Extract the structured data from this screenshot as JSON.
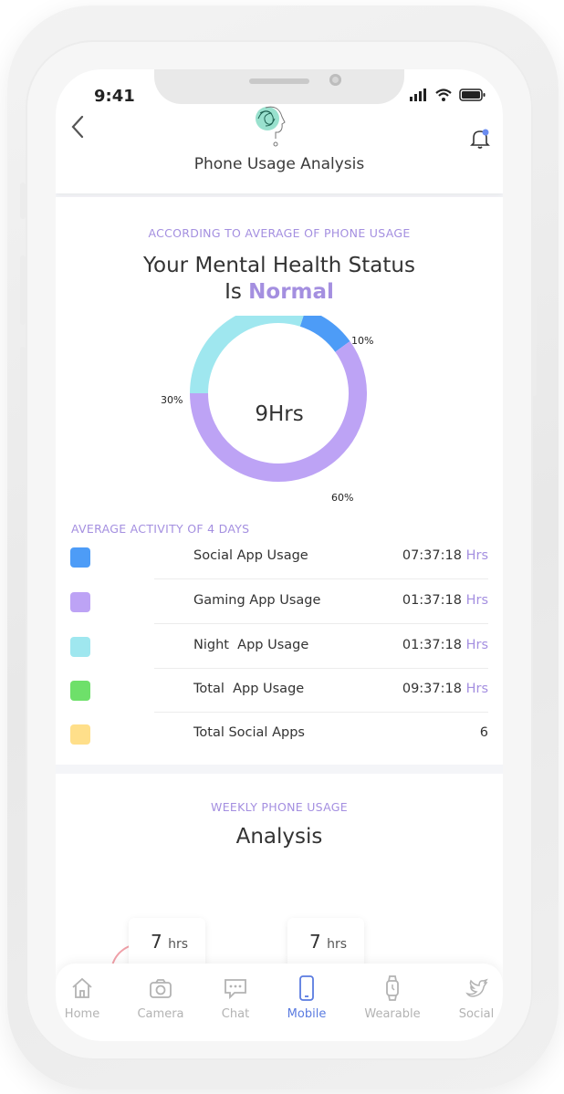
{
  "status_bar": {
    "time": "9:41"
  },
  "header": {
    "title": "Phone Usage Analysis"
  },
  "summary": {
    "caption": "ACCORDING TO AVERAGE OF PHONE USAGE",
    "status_prefix": "Your Mental Health Status",
    "status_is": "Is",
    "status_value": "Normal"
  },
  "chart_data": {
    "type": "pie",
    "center_label": "9Hrs",
    "slices": [
      {
        "label": "10%",
        "value": 10,
        "color": "#4d9cf7"
      },
      {
        "label": "60%",
        "value": 60,
        "color": "#bda3f5"
      },
      {
        "label": "30%",
        "value": 30,
        "color": "#9fe7ef"
      }
    ]
  },
  "activity": {
    "title": "AVERAGE ACTIVITY OF 4 DAYS",
    "rows": [
      {
        "label": "Social App Usage",
        "value": "07:37:18",
        "unit": "Hrs",
        "color": "#4d9cf7"
      },
      {
        "label": "Gaming App Usage",
        "value": "01:37:18",
        "unit": "Hrs",
        "color": "#bda3f5"
      },
      {
        "label": "Night  App Usage",
        "value": "01:37:18",
        "unit": "Hrs",
        "color": "#9fe7ef"
      },
      {
        "label": "Total  App Usage",
        "value": "09:37:18",
        "unit": "Hrs",
        "color": "#6ee06a"
      },
      {
        "label": "Total Social Apps",
        "value": "6",
        "unit": "",
        "color": "#ffdf8a"
      }
    ]
  },
  "weekly": {
    "caption": "WEEKLY PHONE USAGE",
    "title": "Analysis",
    "cards": [
      {
        "num": "7",
        "unit": "hrs"
      },
      {
        "num": "7",
        "unit": "hrs"
      }
    ]
  },
  "nav": {
    "items": [
      {
        "label": "Home",
        "icon": "home-icon"
      },
      {
        "label": "Camera",
        "icon": "camera-icon"
      },
      {
        "label": "Chat",
        "icon": "chat-icon"
      },
      {
        "label": "Mobile",
        "icon": "mobile-icon"
      },
      {
        "label": "Wearable",
        "icon": "watch-icon"
      },
      {
        "label": "Social",
        "icon": "twitter-icon"
      }
    ],
    "active": "Mobile"
  },
  "colors": {
    "accent": "#a48fe0",
    "active_nav": "#5a7be0"
  }
}
